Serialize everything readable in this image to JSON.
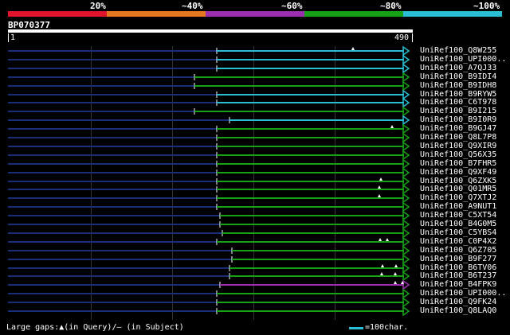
{
  "legend": {
    "labels": [
      "20%",
      "~40%",
      "~60%",
      "~80%",
      "~100%"
    ],
    "colors": [
      "#e0142d",
      "#e37820",
      "#9b2fae",
      "#18a018",
      "#2bbdd1"
    ]
  },
  "query": {
    "name": "BP070377",
    "start": "1",
    "end": "490"
  },
  "hits": [
    {
      "id": "UniRef100_Q8W255",
      "color": "#2bbdd1",
      "start": 272,
      "gaps": [
        443
      ]
    },
    {
      "id": "UniRef100_UPI000..",
      "color": "#2bbdd1",
      "start": 272,
      "gaps": []
    },
    {
      "id": "UniRef100_A7QJ33",
      "color": "#2bbdd1",
      "start": 272,
      "gaps": []
    },
    {
      "id": "UniRef100_B9IDI4",
      "color": "#18a018",
      "start": 244,
      "gaps": []
    },
    {
      "id": "UniRef100_B9IDH8",
      "color": "#18a018",
      "start": 244,
      "gaps": []
    },
    {
      "id": "UniRef100_B9RYW5",
      "color": "#2bbdd1",
      "start": 272,
      "gaps": []
    },
    {
      "id": "UniRef100_C6T978",
      "color": "#2bbdd1",
      "start": 272,
      "gaps": []
    },
    {
      "id": "UniRef100_B9I215",
      "color": "#18a018",
      "start": 244,
      "gaps": []
    },
    {
      "id": "UniRef100_B9I0R9",
      "color": "#2bbdd1",
      "start": 288,
      "gaps": []
    },
    {
      "id": "UniRef100_B9GJ47",
      "color": "#18a018",
      "start": 272,
      "gaps": [
        492
      ]
    },
    {
      "id": "UniRef100_Q8L7P8",
      "color": "#18a018",
      "start": 272,
      "gaps": []
    },
    {
      "id": "UniRef100_Q9XIR9",
      "color": "#18a018",
      "start": 272,
      "gaps": []
    },
    {
      "id": "UniRef100_Q56X35",
      "color": "#18a018",
      "start": 272,
      "gaps": []
    },
    {
      "id": "UniRef100_B7FHR5",
      "color": "#18a018",
      "start": 272,
      "gaps": []
    },
    {
      "id": "UniRef100_Q9XF49",
      "color": "#18a018",
      "start": 272,
      "gaps": []
    },
    {
      "id": "UniRef100_Q6ZXK5",
      "color": "#18a018",
      "start": 272,
      "gaps": [
        478
      ]
    },
    {
      "id": "UniRef100_Q01MR5",
      "color": "#18a018",
      "start": 272,
      "gaps": [
        476
      ]
    },
    {
      "id": "UniRef100_Q7XTJ2",
      "color": "#18a018",
      "start": 272,
      "gaps": [
        476
      ]
    },
    {
      "id": "UniRef100_A9NUT1",
      "color": "#18a018",
      "start": 272,
      "gaps": []
    },
    {
      "id": "UniRef100_C5XT54",
      "color": "#18a018",
      "start": 276,
      "gaps": []
    },
    {
      "id": "UniRef100_B4G0M5",
      "color": "#18a018",
      "start": 276,
      "gaps": []
    },
    {
      "id": "UniRef100_C5YBS4",
      "color": "#18a018",
      "start": 279,
      "gaps": []
    },
    {
      "id": "UniRef100_C0P4X2",
      "color": "#18a018",
      "start": 272,
      "gaps": [
        477,
        486
      ]
    },
    {
      "id": "UniRef100_Q6Z705",
      "color": "#18a018",
      "start": 291,
      "gaps": []
    },
    {
      "id": "UniRef100_B9F277",
      "color": "#18a018",
      "start": 291,
      "gaps": []
    },
    {
      "id": "UniRef100_B6TV06",
      "color": "#18a018",
      "start": 288,
      "gaps": [
        480,
        497
      ]
    },
    {
      "id": "UniRef100_B6T237",
      "color": "#18a018",
      "start": 288,
      "gaps": [
        479,
        496
      ]
    },
    {
      "id": "UniRef100_B4FPK9",
      "color": "#9b2fae",
      "start": 276,
      "gaps": [
        496,
        505
      ]
    },
    {
      "id": "UniRef100_UPI000..",
      "color": "#18a018",
      "start": 272,
      "gaps": []
    },
    {
      "id": "UniRef100_Q9FK24",
      "color": "#18a018",
      "start": 272,
      "gaps": []
    },
    {
      "id": "UniRef100_Q8LAQ0",
      "color": "#18a018",
      "start": 272,
      "gaps": []
    }
  ],
  "footer": {
    "gaps_text": "Large gaps:▲(in Query)/– (in Subject)",
    "scale_text": "=100char."
  }
}
